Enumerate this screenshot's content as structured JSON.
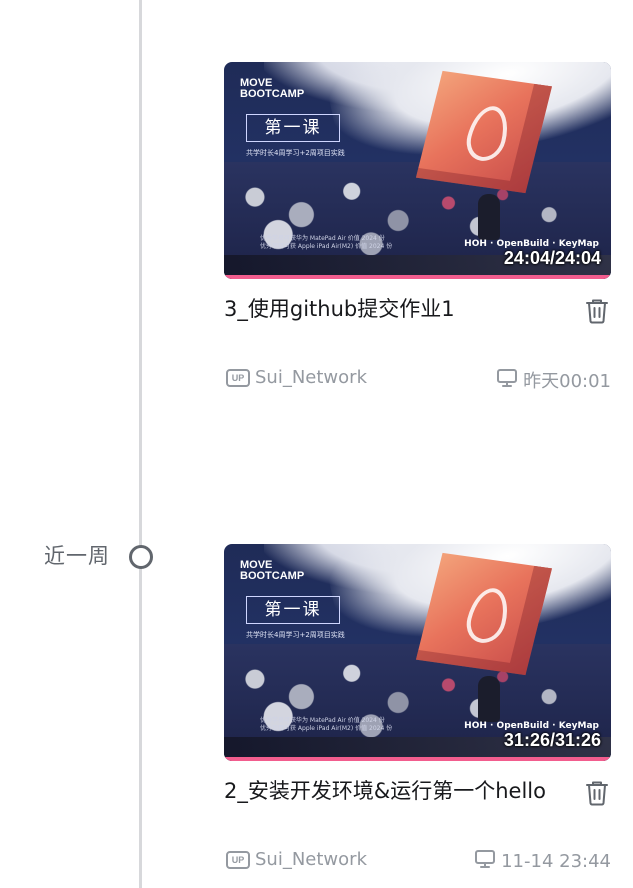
{
  "timeline": {
    "group_label": "近一周"
  },
  "videos": [
    {
      "title": "3_使用github提交作业1",
      "duration": "24:04/24:04",
      "progress": 1.0,
      "uploader": "Sui_Network",
      "up_badge": "UP",
      "watched_time": "昨天00:01",
      "device_icon": "monitor-icon",
      "thumbnail": {
        "brand_line1": "MOVE",
        "brand_line2": "BOOTCAMP",
        "course": "第一课",
        "course_sub": "共学时长4周学习+2周项目实践",
        "sponsor_line1": "优秀学员可获华为 MatePad Air 价值 2024 份",
        "sponsor_line2": "优秀项目可获 Apple iPad Air(M2) 价值 2024 份",
        "partners": "HOH · OpenBuild · KeyMap"
      }
    },
    {
      "title": "2_安装开发环境&运行第一个hello",
      "duration": "31:26/31:26",
      "progress": 1.0,
      "uploader": "Sui_Network",
      "up_badge": "UP",
      "watched_time": "11-14 23:44",
      "device_icon": "monitor-icon",
      "thumbnail": {
        "brand_line1": "MOVE",
        "brand_line2": "BOOTCAMP",
        "course": "第一课",
        "course_sub": "共学时长4周学习+2周项目实践",
        "sponsor_line1": "优秀学员可获华为 MatePad Air 价值 2024 份",
        "sponsor_line2": "优秀项目可获 Apple iPad Air(M2) 价值 2024 份",
        "partners": "HOH · OpenBuild · KeyMap"
      }
    }
  ],
  "colors": {
    "accent": "#f25d8e",
    "muted_text": "#9499a0",
    "timeline": "#d7d8db"
  }
}
